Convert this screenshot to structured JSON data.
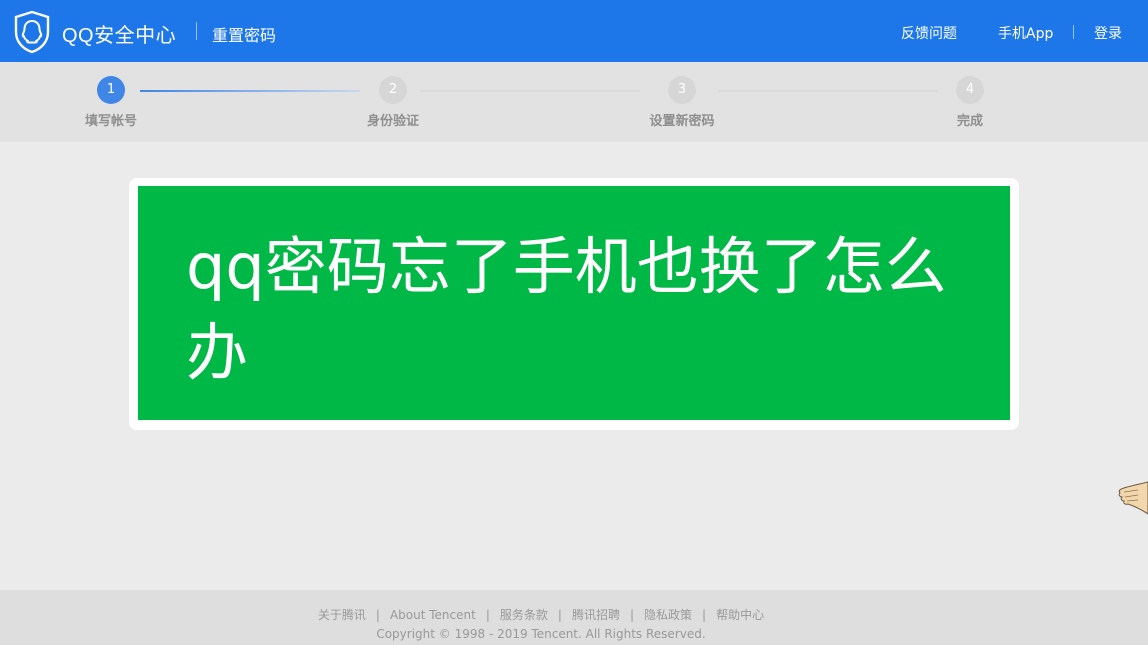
{
  "header": {
    "brand": "QQ安全中心",
    "subtitle": "重置密码",
    "links": {
      "feedback": "反馈问题",
      "mobile_app": "手机App",
      "login": "登录"
    }
  },
  "steps": [
    {
      "number": "1",
      "label": "填写帐号",
      "active": true
    },
    {
      "number": "2",
      "label": "身份验证",
      "active": false
    },
    {
      "number": "3",
      "label": "设置新密码",
      "active": false
    },
    {
      "number": "4",
      "label": "完成",
      "active": false
    }
  ],
  "banner": {
    "text": "qq密码忘了手机也换了怎么办",
    "background": "#00b846"
  },
  "footer": {
    "links": [
      "关于腾讯",
      "About Tencent",
      "服务条款",
      "腾讯招聘",
      "隐私政策",
      "帮助中心"
    ],
    "copyright": "Copyright © 1998 - 2019 Tencent. All Rights Reserved."
  },
  "colors": {
    "header": "#1e77e8",
    "step_active": "#3f86e6",
    "step_inactive": "#d6d6d6"
  },
  "icons": {
    "logo": "qq-shield-icon"
  }
}
